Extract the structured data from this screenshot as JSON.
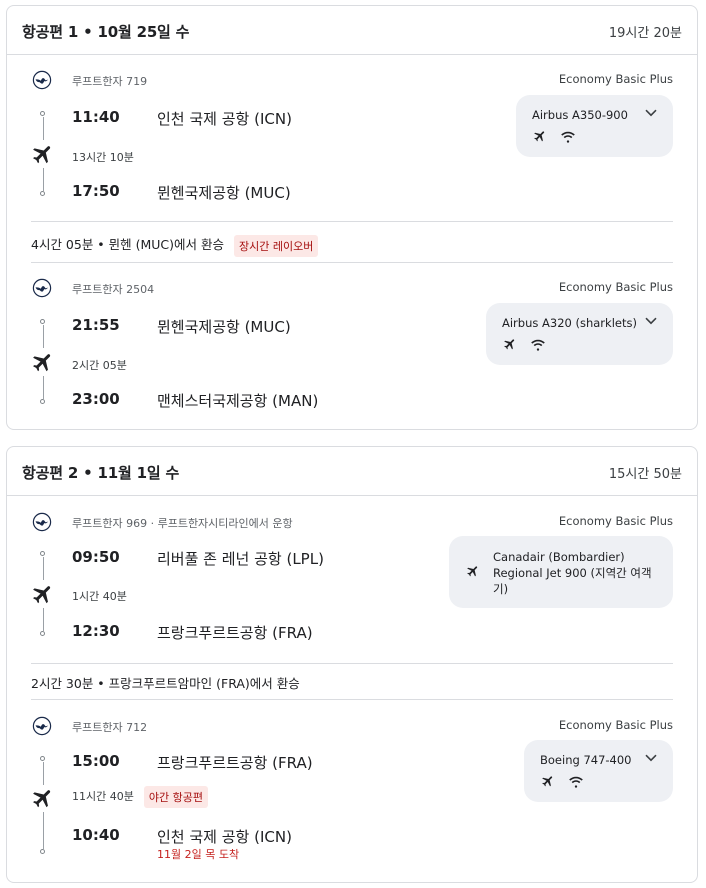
{
  "trips": [
    {
      "title": "항공편 1 • 10월 25일 수",
      "total": "19시간 20분",
      "segments": [
        {
          "flight": "루프트한자 719",
          "cabin": "Economy Basic Plus",
          "dep_time": "11:40",
          "dep_airport": "인천 국제 공항 (ICN)",
          "duration": "13시간 10분",
          "arr_time": "17:50",
          "arr_airport": "뮌헨국제공항 (MUC)",
          "aircraft": "Airbus A350-900"
        },
        {
          "flight": "루프트한자 2504",
          "cabin": "Economy Basic Plus",
          "dep_time": "21:55",
          "dep_airport": "뮌헨국제공항 (MUC)",
          "duration": "2시간 05분",
          "arr_time": "23:00",
          "arr_airport": "맨체스터국제공항 (MAN)",
          "aircraft": "Airbus A320 (sharklets)"
        }
      ],
      "layover": {
        "text": "4시간 05분  •  뮌헨 (MUC)에서 환승",
        "badge": "장시간 레이오버"
      }
    },
    {
      "title": "항공편 2 • 11월 1일 수",
      "total": "15시간 50분",
      "segments": [
        {
          "flight": "루프트한자 969 · 루프트한자시티라인에서 운항",
          "cabin": "Economy Basic Plus",
          "dep_time": "09:50",
          "dep_airport": "리버풀 존 레넌 공항 (LPL)",
          "duration": "1시간 40분",
          "arr_time": "12:30",
          "arr_airport": "프랑크푸르트공항 (FRA)",
          "aircraft_line1": "Canadair (Bombardier)",
          "aircraft_line2": "Regional Jet 900 (지역간 여객",
          "aircraft_line3": "기)"
        },
        {
          "flight": "루프트한자 712",
          "cabin": "Economy Basic Plus",
          "dep_time": "15:00",
          "dep_airport": "프랑크푸르트공항 (FRA)",
          "duration": "11시간 40분",
          "badge": "야간 항공편",
          "arr_time": "10:40",
          "arr_airport": "인천 국제 공항 (ICN)",
          "arrival_note": "11월 2일 목 도착",
          "aircraft": "Boeing 747-400"
        }
      ],
      "layover": {
        "text": "2시간 30분  •  프랑크푸르트암마인 (FRA)에서 환승"
      }
    }
  ],
  "colors": {
    "badge_bg": "#fce8e6",
    "badge_text": "#a50e0e",
    "chip_bg": "#eef0f4",
    "arrival_red": "#c5221f"
  },
  "icons": {
    "airline": "lufthansa-crane-icon",
    "plane": "airplane-icon",
    "wifi": "wifi-icon",
    "expand": "chevron-down-icon"
  }
}
